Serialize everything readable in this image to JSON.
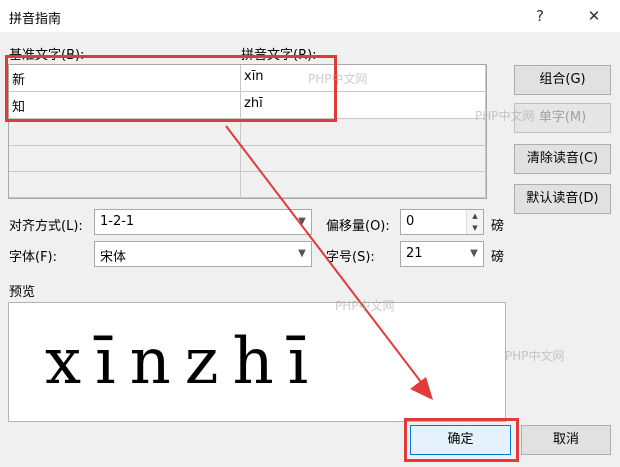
{
  "window": {
    "title": "拼音指南",
    "help": "?",
    "close": "✕"
  },
  "labels": {
    "base": "基准文字(B):",
    "ruby": "拼音文字(R):",
    "preview": "预览"
  },
  "rows": [
    {
      "base": "新",
      "ruby": "xīn"
    },
    {
      "base": "知",
      "ruby": "zhī"
    }
  ],
  "buttons": {
    "group": "组合(G)",
    "single": "单字(M)",
    "clear": "清除读音(C)",
    "default": "默认读音(D)",
    "ok": "确定",
    "cancel": "取消"
  },
  "alignment": {
    "label": "对齐方式(L):",
    "value": "1-2-1"
  },
  "offset": {
    "label": "偏移量(O):",
    "value": "0",
    "unit": "磅"
  },
  "font": {
    "label": "字体(F):",
    "value": "宋体"
  },
  "size": {
    "label": "字号(S):",
    "value": "21",
    "unit": "磅"
  },
  "preview_text": "xīnzhī",
  "watermark": "PHP中文网",
  "colors": {
    "highlight": "#e03a3a",
    "arrow": "#e03a3a"
  }
}
